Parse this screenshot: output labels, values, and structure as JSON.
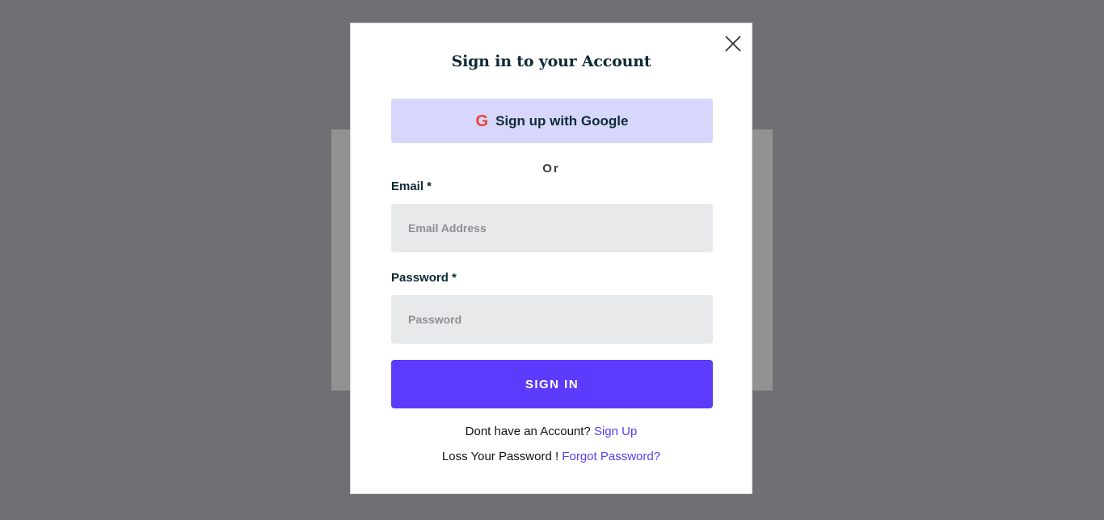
{
  "modal": {
    "title": "Sign in to your Account",
    "google_button_label": "Sign up with Google",
    "google_icon_glyph": "G",
    "divider_text": "Or",
    "email": {
      "label": "Email *",
      "placeholder": "Email Address",
      "value": ""
    },
    "password": {
      "label": "Password *",
      "placeholder": "Password",
      "value": ""
    },
    "signin_button_label": "SIGN IN",
    "signup_prompt": "Dont have an Account?",
    "signup_link": "Sign Up",
    "forgot_prompt": "Loss Your Password !",
    "forgot_link": "Forgot Password?"
  },
  "icons": {
    "close": "close-icon",
    "google": "google-icon"
  },
  "colors": {
    "overlay": "#6f7073",
    "accent": "#5c3bfe",
    "google_button_bg": "#d6d7fb",
    "input_bg": "#e8e9eb",
    "heading_text": "#0f2a36",
    "google_red": "#ea4335"
  }
}
